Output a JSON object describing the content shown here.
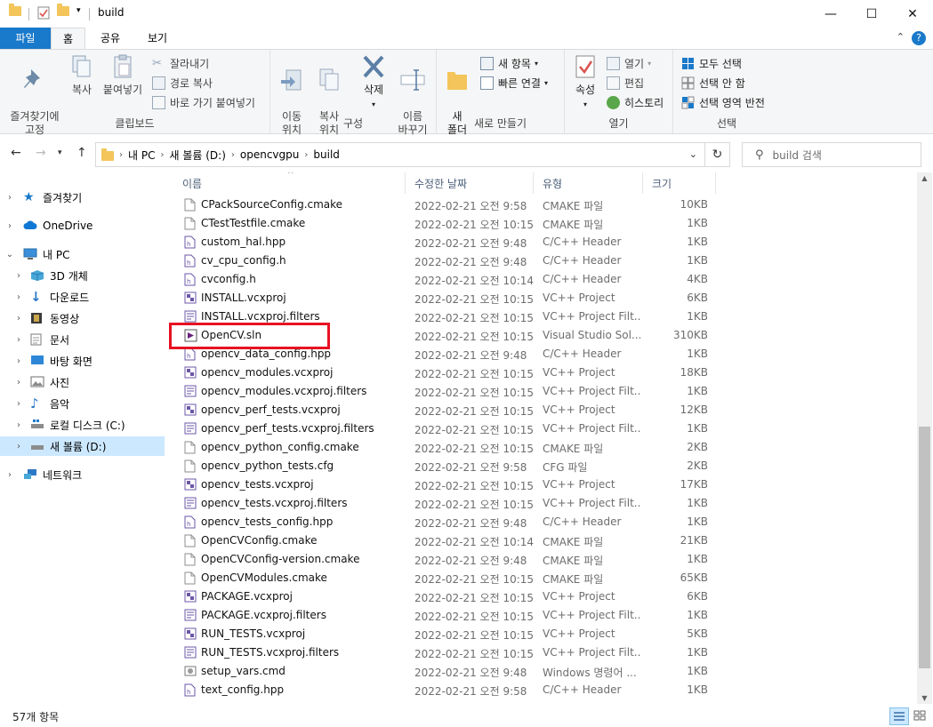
{
  "window": {
    "title": "build",
    "minimize_glyph": "—",
    "maximize_glyph": "☐",
    "close_glyph": "✕"
  },
  "ribbon_tabs": [
    {
      "label": "파일"
    },
    {
      "label": "홈"
    },
    {
      "label": "공유"
    },
    {
      "label": "보기"
    }
  ],
  "help_glyph": "?",
  "clipboard": {
    "label": "클립보드",
    "pin": "즐겨찾기에\n고정",
    "copy": "복사",
    "paste": "붙여넣기",
    "cut": "잘라내기",
    "copy_path": "경로 복사",
    "paste_shortcut": "바로 가기 붙여넣기"
  },
  "organize": {
    "label": "구성",
    "move_to": "이동\n위치",
    "copy_to": "복사\n위치",
    "delete": "삭제",
    "rename": "이름\n바꾸기"
  },
  "new": {
    "label": "새로 만들기",
    "new_folder": "새\n폴더",
    "new_item": "새 항목",
    "easy_access": "빠른 연결"
  },
  "open": {
    "label": "열기",
    "properties": "속성",
    "open": "열기",
    "edit": "편집",
    "history": "히스토리"
  },
  "select": {
    "label": "선택",
    "select_all": "모두 선택",
    "select_none": "선택 안 함",
    "invert": "선택 영역 반전"
  },
  "address": {
    "crumbs": [
      "내 PC",
      "새 볼륨 (D:)",
      "opencvgpu",
      "build"
    ]
  },
  "search": {
    "placeholder": "build 검색"
  },
  "nav_pane": [
    {
      "label": "즐겨찾기",
      "icon": "star-icon",
      "color": "#1979ca"
    },
    {
      "label": "OneDrive",
      "icon": "cloud-icon",
      "color": "#0f78d4"
    },
    {
      "label": "내 PC",
      "icon": "computer-icon",
      "color": "#3a8fd9"
    },
    {
      "label": "3D 개체",
      "icon": "cube-icon",
      "color": "#47a7d8"
    },
    {
      "label": "다운로드",
      "icon": "download-icon",
      "color": "#2c78c6"
    },
    {
      "label": "동영상",
      "icon": "film-icon",
      "color": "#3b3b3b"
    },
    {
      "label": "문서",
      "icon": "document-icon",
      "color": "#7a7a7a"
    },
    {
      "label": "바탕 화면",
      "icon": "desktop-icon",
      "color": "#2e86d6"
    },
    {
      "label": "사진",
      "icon": "picture-icon",
      "color": "#6d6d6d"
    },
    {
      "label": "음악",
      "icon": "music-icon",
      "color": "#2c78c6"
    },
    {
      "label": "로컬 디스크 (C:)",
      "icon": "drive-icon",
      "color": "#6d6d6d"
    },
    {
      "label": "새 볼륨 (D:)",
      "icon": "drive-icon",
      "color": "#6d6d6d"
    },
    {
      "label": "네트워크",
      "icon": "network-icon",
      "color": "#2c78c6"
    }
  ],
  "columns": [
    "이름",
    "수정한 날짜",
    "유형",
    "크기"
  ],
  "files": [
    {
      "name": "CPackSourceConfig.cmake",
      "date": "2022-02-21 오전 9:58",
      "type": "CMAKE 파일",
      "size": "10KB",
      "kind": "plain"
    },
    {
      "name": "CTestTestfile.cmake",
      "date": "2022-02-21 오전 10:15",
      "type": "CMAKE 파일",
      "size": "1KB",
      "kind": "plain"
    },
    {
      "name": "custom_hal.hpp",
      "date": "2022-02-21 오전 9:48",
      "type": "C/C++ Header",
      "size": "1KB",
      "kind": "header"
    },
    {
      "name": "cv_cpu_config.h",
      "date": "2022-02-21 오전 9:48",
      "type": "C/C++ Header",
      "size": "1KB",
      "kind": "header"
    },
    {
      "name": "cvconfig.h",
      "date": "2022-02-21 오전 10:14",
      "type": "C/C++ Header",
      "size": "4KB",
      "kind": "header"
    },
    {
      "name": "INSTALL.vcxproj",
      "date": "2022-02-21 오전 10:15",
      "type": "VC++ Project",
      "size": "6KB",
      "kind": "vc"
    },
    {
      "name": "INSTALL.vcxproj.filters",
      "date": "2022-02-21 오전 10:15",
      "type": "VC++ Project Filt...",
      "size": "1KB",
      "kind": "filter"
    },
    {
      "name": "OpenCV.sln",
      "date": "2022-02-21 오전 10:15",
      "type": "Visual Studio Sol...",
      "size": "310KB",
      "kind": "sln"
    },
    {
      "name": "opencv_data_config.hpp",
      "date": "2022-02-21 오전 9:48",
      "type": "C/C++ Header",
      "size": "1KB",
      "kind": "header"
    },
    {
      "name": "opencv_modules.vcxproj",
      "date": "2022-02-21 오전 10:15",
      "type": "VC++ Project",
      "size": "18KB",
      "kind": "vc"
    },
    {
      "name": "opencv_modules.vcxproj.filters",
      "date": "2022-02-21 오전 10:15",
      "type": "VC++ Project Filt...",
      "size": "1KB",
      "kind": "filter"
    },
    {
      "name": "opencv_perf_tests.vcxproj",
      "date": "2022-02-21 오전 10:15",
      "type": "VC++ Project",
      "size": "12KB",
      "kind": "vc"
    },
    {
      "name": "opencv_perf_tests.vcxproj.filters",
      "date": "2022-02-21 오전 10:15",
      "type": "VC++ Project Filt...",
      "size": "1KB",
      "kind": "filter"
    },
    {
      "name": "opencv_python_config.cmake",
      "date": "2022-02-21 오전 10:15",
      "type": "CMAKE 파일",
      "size": "2KB",
      "kind": "plain"
    },
    {
      "name": "opencv_python_tests.cfg",
      "date": "2022-02-21 오전 9:58",
      "type": "CFG 파일",
      "size": "2KB",
      "kind": "plain"
    },
    {
      "name": "opencv_tests.vcxproj",
      "date": "2022-02-21 오전 10:15",
      "type": "VC++ Project",
      "size": "17KB",
      "kind": "vc"
    },
    {
      "name": "opencv_tests.vcxproj.filters",
      "date": "2022-02-21 오전 10:15",
      "type": "VC++ Project Filt...",
      "size": "1KB",
      "kind": "filter"
    },
    {
      "name": "opencv_tests_config.hpp",
      "date": "2022-02-21 오전 9:48",
      "type": "C/C++ Header",
      "size": "1KB",
      "kind": "header"
    },
    {
      "name": "OpenCVConfig.cmake",
      "date": "2022-02-21 오전 10:14",
      "type": "CMAKE 파일",
      "size": "21KB",
      "kind": "plain"
    },
    {
      "name": "OpenCVConfig-version.cmake",
      "date": "2022-02-21 오전 9:48",
      "type": "CMAKE 파일",
      "size": "1KB",
      "kind": "plain"
    },
    {
      "name": "OpenCVModules.cmake",
      "date": "2022-02-21 오전 10:15",
      "type": "CMAKE 파일",
      "size": "65KB",
      "kind": "plain"
    },
    {
      "name": "PACKAGE.vcxproj",
      "date": "2022-02-21 오전 10:15",
      "type": "VC++ Project",
      "size": "6KB",
      "kind": "vc"
    },
    {
      "name": "PACKAGE.vcxproj.filters",
      "date": "2022-02-21 오전 10:15",
      "type": "VC++ Project Filt...",
      "size": "1KB",
      "kind": "filter"
    },
    {
      "name": "RUN_TESTS.vcxproj",
      "date": "2022-02-21 오전 10:15",
      "type": "VC++ Project",
      "size": "5KB",
      "kind": "vc"
    },
    {
      "name": "RUN_TESTS.vcxproj.filters",
      "date": "2022-02-21 오전 10:15",
      "type": "VC++ Project Filt...",
      "size": "1KB",
      "kind": "filter"
    },
    {
      "name": "setup_vars.cmd",
      "date": "2022-02-21 오전 9:48",
      "type": "Windows 명령어 ...",
      "size": "1KB",
      "kind": "cmd"
    },
    {
      "name": "text_config.hpp",
      "date": "2022-02-21 오전 9:58",
      "type": "C/C++ Header",
      "size": "1KB",
      "kind": "header"
    }
  ],
  "status": {
    "item_count": "57개 항목"
  },
  "colors": {
    "accent": "#1979ca",
    "selection": "#cce8ff",
    "highlight_box": "#e81123"
  }
}
